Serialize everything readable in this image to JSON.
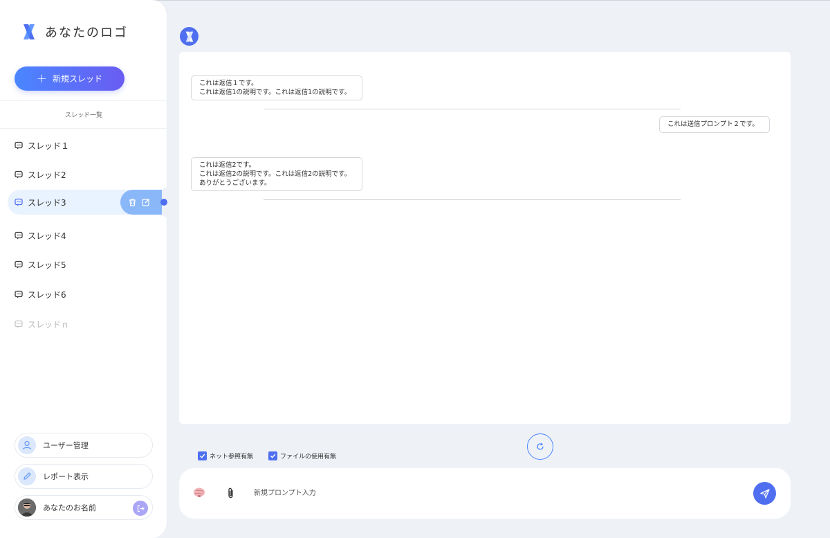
{
  "app": {
    "logo_text": "あなたのロゴ"
  },
  "sidebar": {
    "new_thread_label": "新規スレッド",
    "thread_list_header": "スレッド一覧",
    "threads": [
      {
        "label": "スレッド１",
        "state": "normal"
      },
      {
        "label": "スレッド2",
        "state": "normal"
      },
      {
        "label": "スレッド3",
        "state": "active"
      },
      {
        "label": "スレッド4",
        "state": "normal"
      },
      {
        "label": "スレッド5",
        "state": "normal"
      },
      {
        "label": "スレッド6",
        "state": "normal"
      },
      {
        "label": "スレッドｎ",
        "state": "faded"
      }
    ],
    "thread_actions": [
      "trash-icon",
      "edit-icon"
    ],
    "user_management_label": "ユーザー管理",
    "report_label": "レポート表示",
    "user_name": "あなたのお名前"
  },
  "chat": {
    "messages": [
      {
        "role": "bot",
        "lines": [
          "これは返信１です。",
          "これは返信1の説明です。これは返信1の説明です。"
        ]
      },
      {
        "role": "user",
        "lines": [
          "これは送信プロンプト２です。"
        ]
      },
      {
        "role": "bot",
        "lines": [
          "これは返信2です。",
          "これは返信2の説明です。これは返信2の説明です。",
          "ありがとうございます。"
        ]
      }
    ]
  },
  "options": {
    "net_reference_label": "ネット参照有無",
    "net_reference_checked": true,
    "file_use_label": "ファイルの使用有無",
    "file_use_checked": true
  },
  "composer": {
    "placeholder": "新規プロンプト入力",
    "value": ""
  },
  "colors": {
    "accent": "#4f6ff0",
    "gradient_start": "#4a86ff",
    "gradient_end": "#6a5cf2",
    "active_thread_bg": "#e9f2ff",
    "thread_actions_bg": "#8ab7f8",
    "page_bg": "#eef1f6"
  }
}
